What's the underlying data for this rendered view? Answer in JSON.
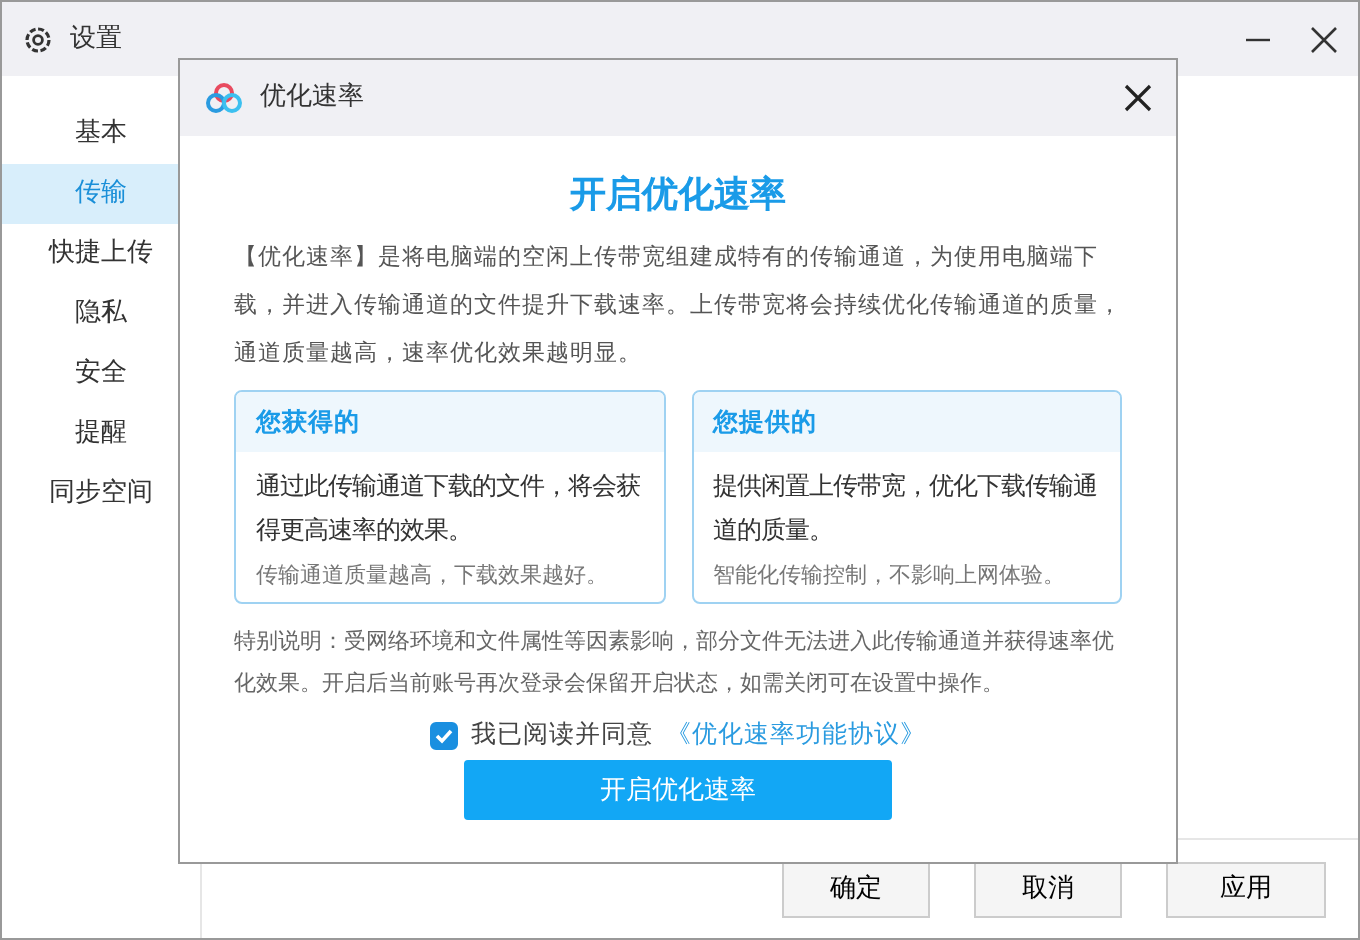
{
  "window": {
    "title": "设置"
  },
  "sidebar": {
    "items": [
      {
        "label": "基本",
        "selected": false
      },
      {
        "label": "传输",
        "selected": true
      },
      {
        "label": "快捷上传",
        "selected": false
      },
      {
        "label": "隐私",
        "selected": false
      },
      {
        "label": "安全",
        "selected": false
      },
      {
        "label": "提醒",
        "selected": false
      },
      {
        "label": "同步空间",
        "selected": false
      }
    ]
  },
  "footer_buttons": [
    "确定",
    "取消",
    "应用"
  ],
  "dialog": {
    "title": "优化速率",
    "heading": "开启优化速率",
    "description": "【优化速率】是将电脑端的空闲上传带宽组建成特有的传输通道，为使用电脑端下载，并进入传输通道的文件提升下载速率。上传带宽将会持续优化传输通道的质量，通道质量越高，速率优化效果越明显。",
    "cards": [
      {
        "title": "您获得的",
        "body": "通过此传输通道下载的文件，将会获得更高速率的效果。",
        "note": "传输通道质量越高，下载效果越好。"
      },
      {
        "title": "您提供的",
        "body": "提供闲置上传带宽，优化下载传输通道的质量。",
        "note": "智能化传输控制，不影响上网体验。"
      }
    ],
    "notice": "特别说明：受网络环境和文件属性等因素影响，部分文件无法进入此传输通道并获得速率优化效果。开启后当前账号再次登录会保留开启状态，如需关闭可在设置中操作。",
    "agreement": {
      "checked": true,
      "label": "我已阅读并同意",
      "link": "《优化速率功能协议》"
    },
    "button": "开启优化速率"
  }
}
